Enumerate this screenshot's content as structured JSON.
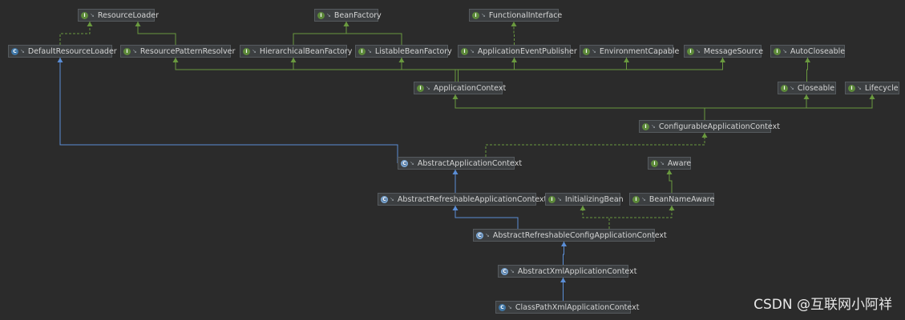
{
  "nodes": [
    {
      "id": "ResourceLoader",
      "label": "ResourceLoader",
      "kind": "interface"
    },
    {
      "id": "BeanFactory",
      "label": "BeanFactory",
      "kind": "interface"
    },
    {
      "id": "FunctionalInterface",
      "label": "FunctionalInterface",
      "kind": "interface"
    },
    {
      "id": "DefaultResourceLoader",
      "label": "DefaultResourceLoader",
      "kind": "class"
    },
    {
      "id": "ResourcePatternResolver",
      "label": "ResourcePatternResolver",
      "kind": "interface"
    },
    {
      "id": "HierarchicalBeanFactory",
      "label": "HierarchicalBeanFactory",
      "kind": "interface"
    },
    {
      "id": "ListableBeanFactory",
      "label": "ListableBeanFactory",
      "kind": "interface"
    },
    {
      "id": "ApplicationEventPublisher",
      "label": "ApplicationEventPublisher",
      "kind": "interface"
    },
    {
      "id": "EnvironmentCapable",
      "label": "EnvironmentCapable",
      "kind": "interface"
    },
    {
      "id": "MessageSource",
      "label": "MessageSource",
      "kind": "interface"
    },
    {
      "id": "AutoCloseable",
      "label": "AutoCloseable",
      "kind": "interface"
    },
    {
      "id": "ApplicationContext",
      "label": "ApplicationContext",
      "kind": "interface"
    },
    {
      "id": "Closeable",
      "label": "Closeable",
      "kind": "interface"
    },
    {
      "id": "Lifecycle",
      "label": "Lifecycle",
      "kind": "interface"
    },
    {
      "id": "ConfigurableApplicationContext",
      "label": "ConfigurableApplicationContext",
      "kind": "interface"
    },
    {
      "id": "AbstractApplicationContext",
      "label": "AbstractApplicationContext",
      "kind": "abstract"
    },
    {
      "id": "Aware",
      "label": "Aware",
      "kind": "interface"
    },
    {
      "id": "AbstractRefreshableApplicationContext",
      "label": "AbstractRefreshableApplicationContext",
      "kind": "abstract"
    },
    {
      "id": "InitializingBean",
      "label": "InitializingBean",
      "kind": "interface"
    },
    {
      "id": "BeanNameAware",
      "label": "BeanNameAware",
      "kind": "interface"
    },
    {
      "id": "AbstractRefreshableConfigApplicationContext",
      "label": "AbstractRefreshableConfigApplicationContext",
      "kind": "abstract"
    },
    {
      "id": "AbstractXmlApplicationContext",
      "label": "AbstractXmlApplicationContext",
      "kind": "abstract"
    },
    {
      "id": "ClassPathXmlApplicationContext",
      "label": "ClassPathXmlApplicationContext",
      "kind": "class"
    }
  ],
  "edges": [
    {
      "from": "DefaultResourceLoader",
      "to": "ResourceLoader",
      "type": "implements"
    },
    {
      "from": "ResourcePatternResolver",
      "to": "ResourceLoader",
      "type": "extends-interface"
    },
    {
      "from": "HierarchicalBeanFactory",
      "to": "BeanFactory",
      "type": "extends-interface"
    },
    {
      "from": "ListableBeanFactory",
      "to": "BeanFactory",
      "type": "extends-interface"
    },
    {
      "from": "ApplicationEventPublisher",
      "to": "FunctionalInterface",
      "type": "implements"
    },
    {
      "from": "ApplicationContext",
      "to": "ResourcePatternResolver",
      "type": "extends-interface"
    },
    {
      "from": "ApplicationContext",
      "to": "HierarchicalBeanFactory",
      "type": "extends-interface"
    },
    {
      "from": "ApplicationContext",
      "to": "ListableBeanFactory",
      "type": "extends-interface"
    },
    {
      "from": "ApplicationContext",
      "to": "ApplicationEventPublisher",
      "type": "extends-interface"
    },
    {
      "from": "ApplicationContext",
      "to": "EnvironmentCapable",
      "type": "extends-interface"
    },
    {
      "from": "ApplicationContext",
      "to": "MessageSource",
      "type": "extends-interface"
    },
    {
      "from": "Closeable",
      "to": "AutoCloseable",
      "type": "extends-interface"
    },
    {
      "from": "ConfigurableApplicationContext",
      "to": "ApplicationContext",
      "type": "extends-interface"
    },
    {
      "from": "ConfigurableApplicationContext",
      "to": "Closeable",
      "type": "extends-interface"
    },
    {
      "from": "ConfigurableApplicationContext",
      "to": "Lifecycle",
      "type": "extends-interface"
    },
    {
      "from": "AbstractApplicationContext",
      "to": "ConfigurableApplicationContext",
      "type": "implements"
    },
    {
      "from": "AbstractApplicationContext",
      "to": "DefaultResourceLoader",
      "type": "extends-class"
    },
    {
      "from": "AbstractRefreshableApplicationContext",
      "to": "AbstractApplicationContext",
      "type": "extends-class"
    },
    {
      "from": "BeanNameAware",
      "to": "Aware",
      "type": "extends-interface"
    },
    {
      "from": "AbstractRefreshableConfigApplicationContext",
      "to": "AbstractRefreshableApplicationContext",
      "type": "extends-class"
    },
    {
      "from": "AbstractRefreshableConfigApplicationContext",
      "to": "InitializingBean",
      "type": "implements"
    },
    {
      "from": "AbstractRefreshableConfigApplicationContext",
      "to": "BeanNameAware",
      "type": "implements"
    },
    {
      "from": "AbstractXmlApplicationContext",
      "to": "AbstractRefreshableConfigApplicationContext",
      "type": "extends-class"
    },
    {
      "from": "ClassPathXmlApplicationContext",
      "to": "AbstractXmlApplicationContext",
      "type": "extends-class"
    }
  ],
  "colors": {
    "background": "#2b2b2b",
    "interface_edge": "#6a9a3f",
    "class_edge": "#5b8ed6",
    "implements_edge": "#6a9a3f"
  },
  "icons": {
    "interface": "interface-icon",
    "class": "class-icon",
    "abstract": "abstract-class-icon"
  },
  "watermark": "CSDN @互联网小阿祥"
}
